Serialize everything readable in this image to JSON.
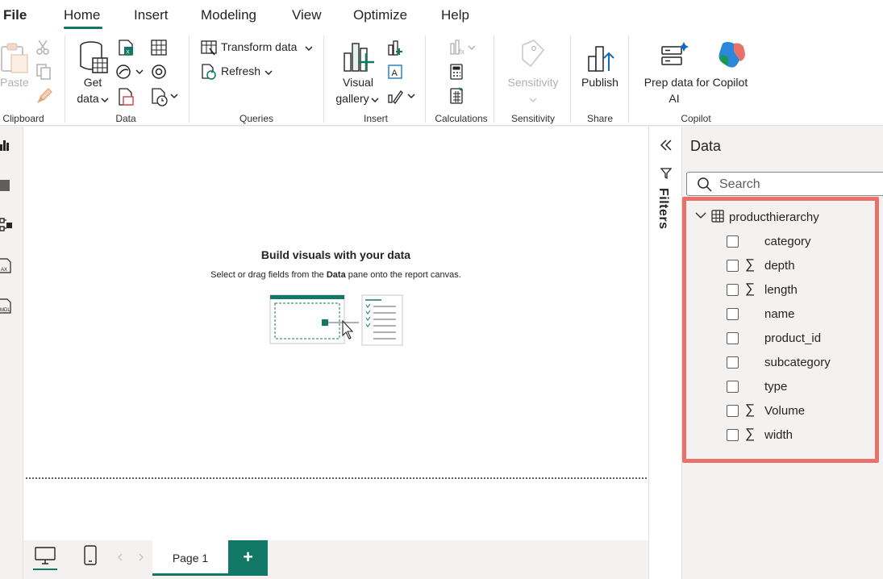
{
  "menu": {
    "file": "File",
    "home": "Home",
    "insert": "Insert",
    "modeling": "Modeling",
    "view": "View",
    "optimize": "Optimize",
    "help": "Help"
  },
  "ribbon": {
    "clipboard": {
      "paste": "Paste",
      "label": "Clipboard"
    },
    "data": {
      "get_data_1": "Get",
      "get_data_2": "data",
      "label": "Data"
    },
    "queries": {
      "transform": "Transform data",
      "refresh": "Refresh",
      "label": "Queries"
    },
    "insert": {
      "visual_gallery_1": "Visual",
      "visual_gallery_2": "gallery",
      "label": "Insert"
    },
    "calculations": {
      "label": "Calculations"
    },
    "sensitivity": {
      "button": "Sensitivity",
      "label": "Sensitivity"
    },
    "share": {
      "publish": "Publish",
      "label": "Share"
    },
    "copilot": {
      "prep_1": "Prep data for Copilot",
      "prep_2": "AI",
      "label": "Copilot"
    }
  },
  "canvas": {
    "title": "Build visuals with your data",
    "subtitle_pre": "Select or drag fields from the ",
    "subtitle_bold": "Data",
    "subtitle_post": " pane onto the report canvas."
  },
  "pages": {
    "page1": "Page 1",
    "add": "+"
  },
  "filters": {
    "label": "Filters"
  },
  "data_pane": {
    "title": "Data",
    "search_placeholder": "Search",
    "table": "producthierarchy",
    "fields": [
      {
        "name": "category",
        "numeric": false
      },
      {
        "name": "depth",
        "numeric": true
      },
      {
        "name": "length",
        "numeric": true
      },
      {
        "name": "name",
        "numeric": false
      },
      {
        "name": "product_id",
        "numeric": false
      },
      {
        "name": "subcategory",
        "numeric": false
      },
      {
        "name": "type",
        "numeric": false
      },
      {
        "name": "Volume",
        "numeric": true
      },
      {
        "name": "width",
        "numeric": true
      }
    ],
    "sigma": "∑"
  },
  "colors": {
    "accent": "#117865",
    "highlight": "#e8716a"
  }
}
